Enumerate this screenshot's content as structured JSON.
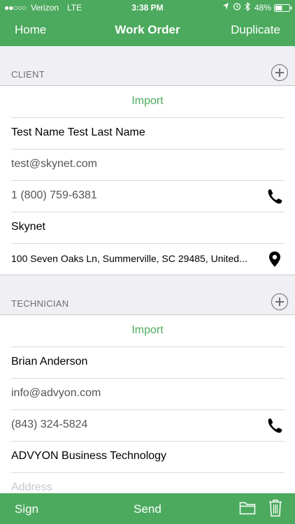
{
  "status": {
    "carrier": "Verizon",
    "network": "LTE",
    "time": "3:38 PM",
    "battery": "48%"
  },
  "nav": {
    "back_label": "Home",
    "title": "Work Order",
    "action_label": "Duplicate"
  },
  "client": {
    "header": "CLIENT",
    "import_label": "Import",
    "name": "Test Name Test Last Name",
    "email": "test@skynet.com",
    "phone": "1 (800) 759-6381",
    "company": "Skynet",
    "address": "100 Seven Oaks Ln, Summerville, SC 29485, United..."
  },
  "technician": {
    "header": "TECHNICIAN",
    "import_label": "Import",
    "name": "Brian Anderson",
    "email": "info@advyon.com",
    "phone": "(843) 324-5824",
    "company": "ADVYON Business Technology",
    "address_placeholder": "Address"
  },
  "toolbar": {
    "sign_label": "Sign",
    "send_label": "Send",
    "folder_icon": "folder-icon",
    "trash_icon": "trash-icon"
  },
  "colors": {
    "accent": "#4caa5e",
    "background": "#efeff4"
  }
}
